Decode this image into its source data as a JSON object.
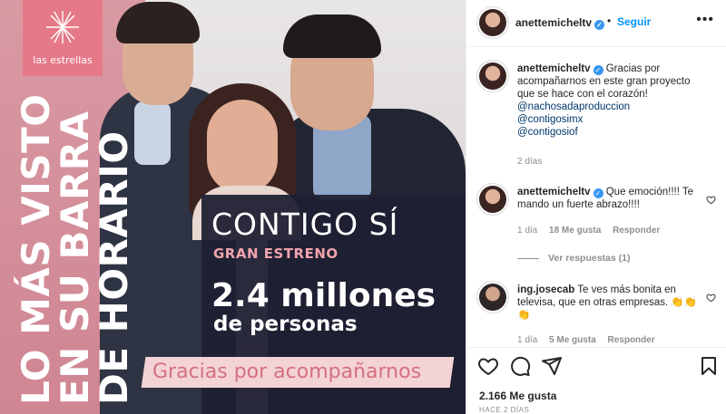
{
  "image": {
    "logo_text": "las estrellas",
    "vertical_lines": [
      "LO MÁS VISTO",
      "EN SU BARRA",
      "DE HORARIO"
    ],
    "title": "CONTIGO SÍ",
    "subtitle": "GRAN ESTRENO",
    "big_number": "2.4 millones",
    "big_sub": "de personas",
    "thanks": "Gracias por acompañarnos"
  },
  "header": {
    "username": "anettemicheltv",
    "dot": "•",
    "follow": "Seguir",
    "more": "•••"
  },
  "caption": {
    "username": "anettemicheltv",
    "text": "Gracias por acompañarnos en este gran proyecto que se hace con el corazón!",
    "mentions": [
      "@nachosadaproduccion",
      "@contigosimx",
      "@contigosiof"
    ],
    "time": "2 días"
  },
  "comments": [
    {
      "username": "anettemicheltv",
      "text": "Que emoción!!!! Te mando un fuerte abrazo!!!!",
      "time": "1 día",
      "likes": "18 Me gusta",
      "reply": "Responder",
      "view_replies": "Ver respuestas (1)"
    },
    {
      "username": "ing.josecab",
      "text": "Te ves más bonita en televisa, que en otras empresas. 👏👏👏",
      "time": "1 día",
      "likes": "5 Me gusta",
      "reply": "Responder"
    }
  ],
  "footer": {
    "likes": "2.166 Me gusta",
    "ago": "HACE 2 DÍAS"
  },
  "colors": {
    "link": "#0095f6",
    "mention": "#00376b",
    "pink": "#e57987",
    "panel": "#1e1f32"
  }
}
